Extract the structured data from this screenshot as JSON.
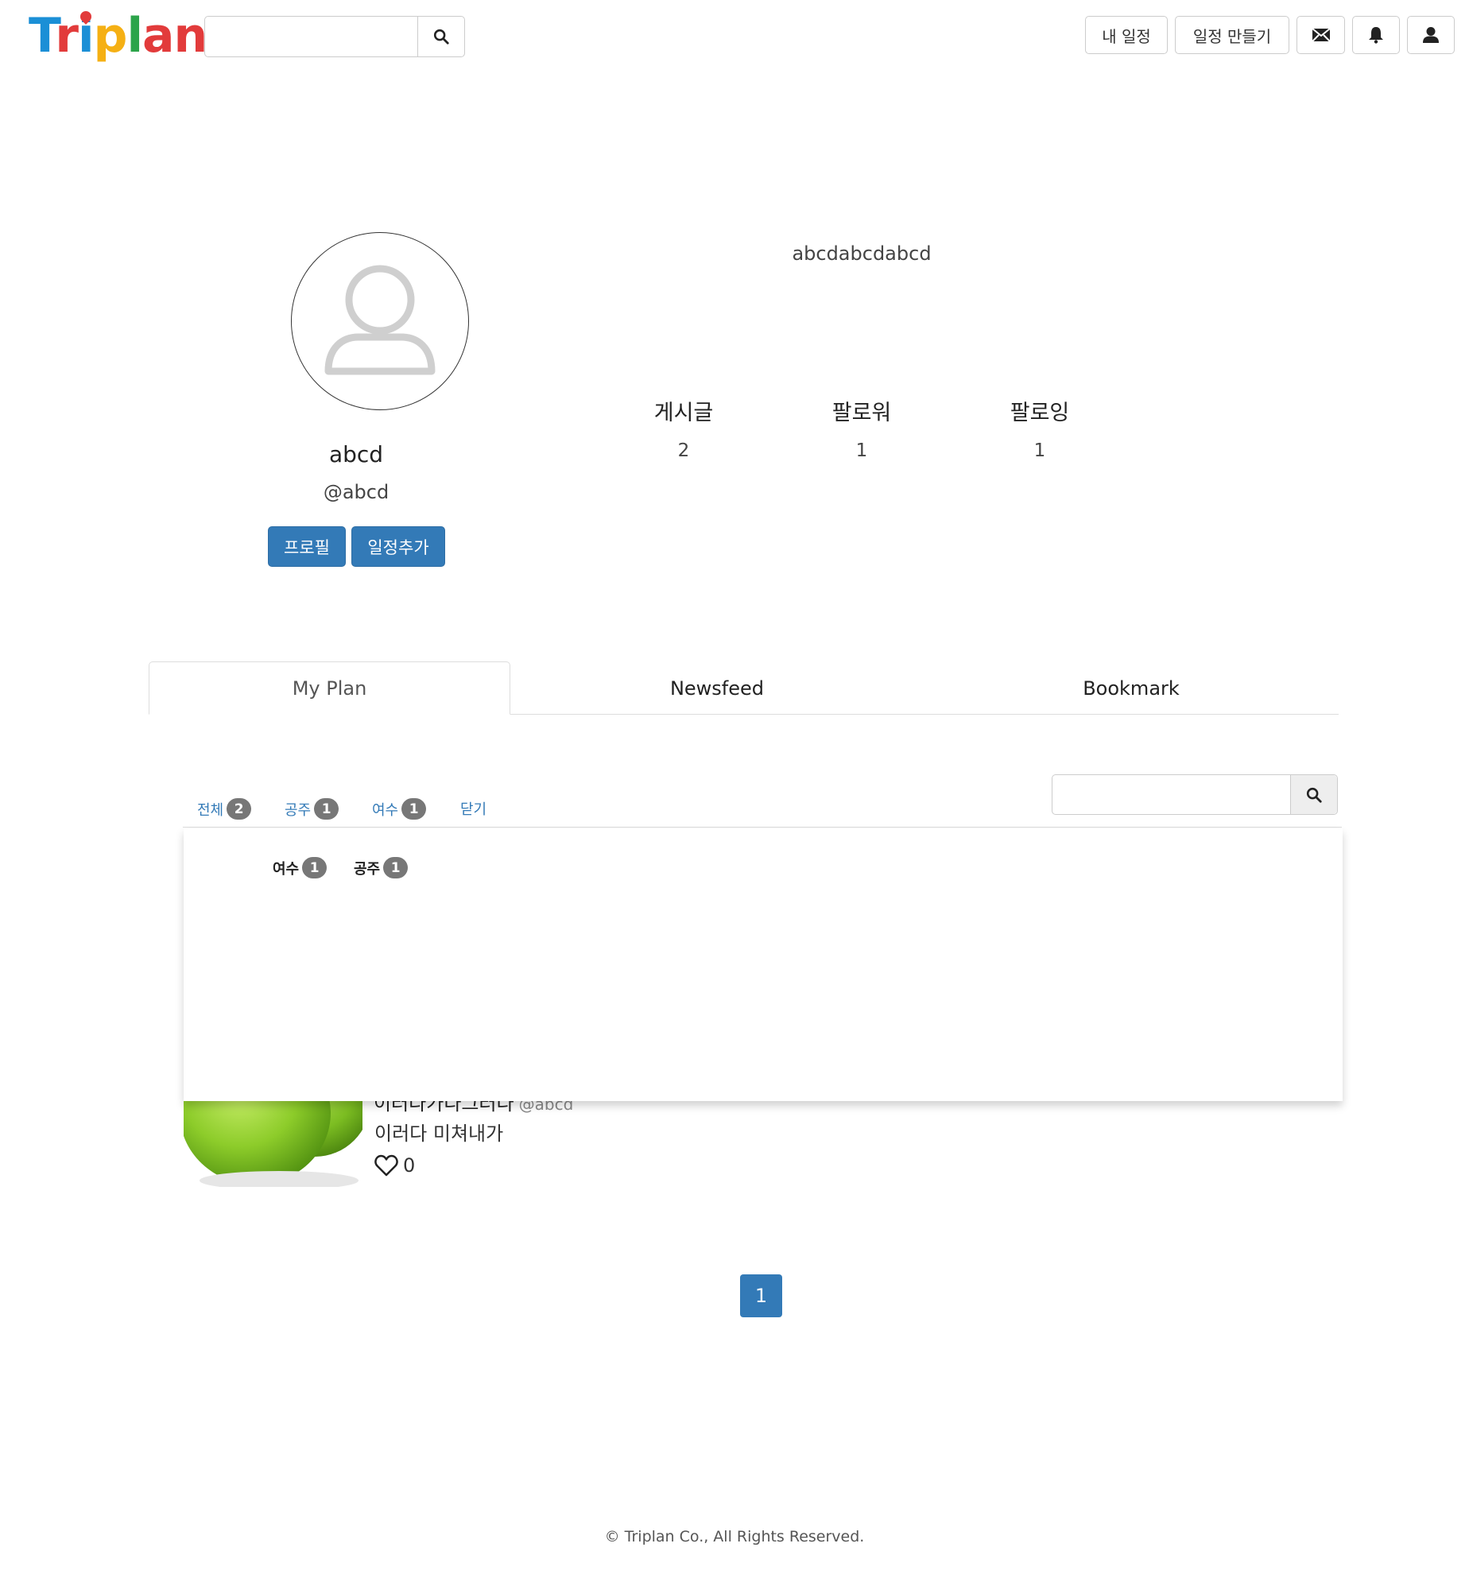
{
  "header": {
    "logo": {
      "t": "T",
      "r": "r",
      "i": "i",
      "p": "p",
      "l": "l",
      "a": "a",
      "n": "n"
    },
    "search": {
      "placeholder": ""
    },
    "nav": {
      "my_schedule": "내 일정",
      "create_schedule": "일정 만들기"
    },
    "icons": [
      "search-icon",
      "mail-icon",
      "bell-icon",
      "user-icon"
    ]
  },
  "profile": {
    "name": "abcd",
    "handle": "@abcd",
    "bio": "abcdabcdabcd",
    "buttons": {
      "profile": "프로필",
      "add_schedule": "일정추가"
    },
    "stats": [
      {
        "label": "게시글",
        "value": "2"
      },
      {
        "label": "팔로워",
        "value": "1"
      },
      {
        "label": "팔로잉",
        "value": "1"
      }
    ]
  },
  "tabs": [
    {
      "label": "My Plan",
      "active": true
    },
    {
      "label": "Newsfeed",
      "active": false
    },
    {
      "label": "Bookmark",
      "active": false
    }
  ],
  "filters": [
    {
      "label": "전체",
      "count": "2"
    },
    {
      "label": "공주",
      "count": "1"
    },
    {
      "label": "여수",
      "count": "1"
    },
    {
      "label": "닫기",
      "count": null
    }
  ],
  "dropdown_tags": [
    {
      "label": "여수",
      "count": "1"
    },
    {
      "label": "공주",
      "count": "1"
    }
  ],
  "post": {
    "title": "이러다가다그러다",
    "handle": "@abcd",
    "body": "이러다 미쳐내가",
    "likes": "0"
  },
  "pagination": {
    "current": "1"
  },
  "footer": {
    "text": "© Triplan Co., All Rights Reserved."
  },
  "colors": {
    "primary": "#337ab7",
    "badge": "#777777"
  }
}
